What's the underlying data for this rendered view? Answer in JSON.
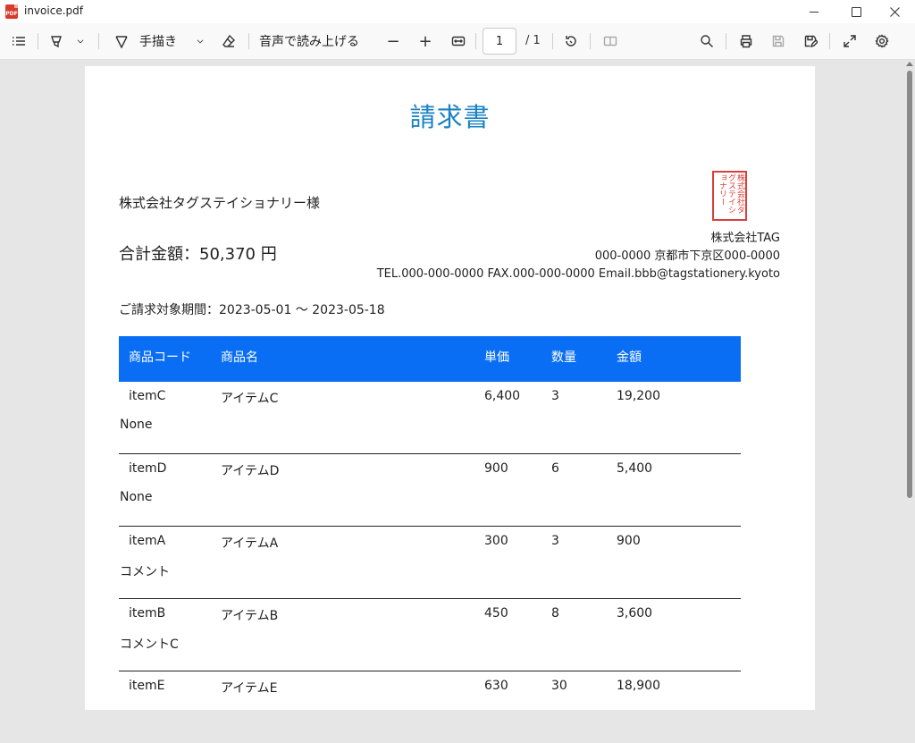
{
  "window": {
    "title": "invoice.pdf",
    "app_icon": "pdf-file-icon",
    "controls": [
      "minimize",
      "maximize",
      "close"
    ]
  },
  "toolbar": {
    "draw_label": "手描き",
    "read_aloud_label": "音声で読み上げる",
    "zoom_out": "−",
    "zoom_in": "+",
    "page_number": "1",
    "page_total": "/ 1",
    "icons": [
      "contents-icon",
      "highlight-icon",
      "chevron-down-icon",
      "draw-icon",
      "chevron-down-icon",
      "eraser-icon",
      "fit-width-icon",
      "rotate-icon",
      "two-page-icon",
      "search-icon",
      "print-icon",
      "save-icon",
      "save-as-icon",
      "fullscreen-icon",
      "settings-icon"
    ]
  },
  "invoice": {
    "title": "請求書",
    "customer": "株式会社タグステイショナリー様",
    "total": "合計金額：50,370 円",
    "seal_text": "株式会社タグステイショナリー",
    "company": {
      "name": "株式会社TAG",
      "address": "000-0000 京都市下京区000-0000",
      "contact": "TEL.000-000-0000 FAX.000-000-0000 Email.bbb@tagstationery.kyoto"
    },
    "period": "ご請求対象期間：2023-05-01 ～ 2023-05-18",
    "columns": [
      "商品コード",
      "商品名",
      "単価",
      "数量",
      "金額"
    ],
    "rows": [
      {
        "code": "itemC",
        "name": "アイテムC",
        "price": "6,400",
        "qty": "3",
        "amount": "19,200",
        "comment": "None"
      },
      {
        "code": "itemD",
        "name": "アイテムD",
        "price": "900",
        "qty": "6",
        "amount": "5,400",
        "comment": "None"
      },
      {
        "code": "itemA",
        "name": "アイテムA",
        "price": "300",
        "qty": "3",
        "amount": "900",
        "comment": "コメント"
      },
      {
        "code": "itemB",
        "name": "アイテムB",
        "price": "450",
        "qty": "8",
        "amount": "3,600",
        "comment": "コメントC"
      },
      {
        "code": "itemE",
        "name": "アイテムE",
        "price": "630",
        "qty": "30",
        "amount": "18,900",
        "comment": ""
      }
    ]
  },
  "colors": {
    "title": "#1a82c2",
    "table_header": "#0a6ef5",
    "seal": "#d9403a",
    "viewer_bg": "#e6e6e6"
  }
}
